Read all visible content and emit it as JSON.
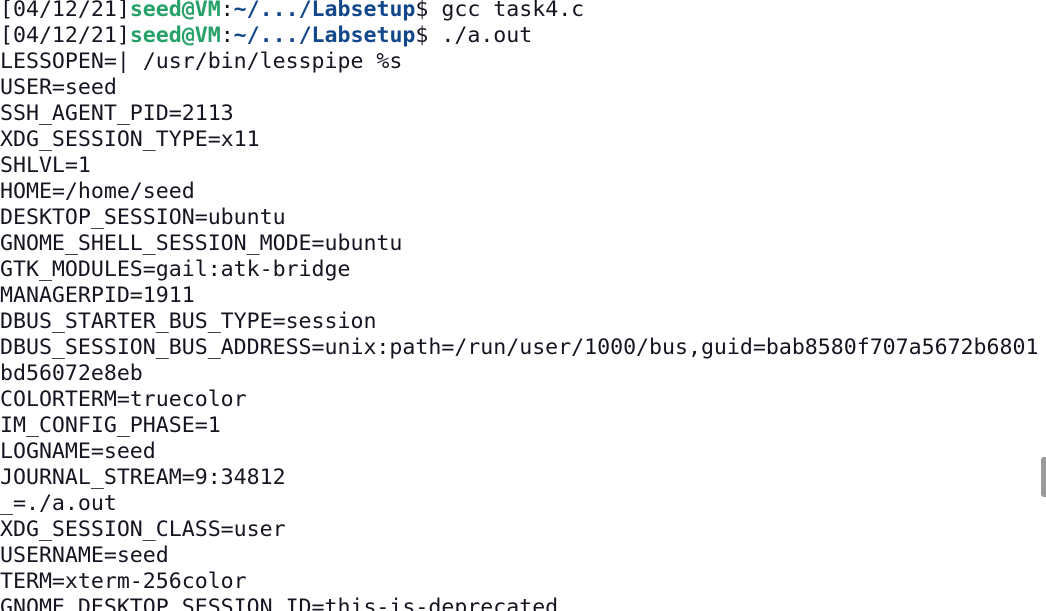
{
  "terminal": {
    "prompts": [
      {
        "time": "[04/12/21]",
        "user": "seed@VM",
        "sep": ":",
        "path": "~/.../Labsetup",
        "suffix": "$ ",
        "command": "gcc task4.c"
      },
      {
        "time": "[04/12/21]",
        "user": "seed@VM",
        "sep": ":",
        "path": "~/.../Labsetup",
        "suffix": "$ ",
        "command": "./a.out"
      }
    ],
    "output": [
      "LESSOPEN=| /usr/bin/lesspipe %s",
      "USER=seed",
      "SSH_AGENT_PID=2113",
      "XDG_SESSION_TYPE=x11",
      "SHLVL=1",
      "HOME=/home/seed",
      "DESKTOP_SESSION=ubuntu",
      "GNOME_SHELL_SESSION_MODE=ubuntu",
      "GTK_MODULES=gail:atk-bridge",
      "MANAGERPID=1911",
      "DBUS_STARTER_BUS_TYPE=session",
      "DBUS_SESSION_BUS_ADDRESS=unix:path=/run/user/1000/bus,guid=bab8580f707a5672b6801",
      "bd56072e8eb",
      "COLORTERM=truecolor",
      "IM_CONFIG_PHASE=1",
      "LOGNAME=seed",
      "JOURNAL_STREAM=9:34812",
      "_=./a.out",
      "XDG_SESSION_CLASS=user",
      "USERNAME=seed",
      "TERM=xterm-256color",
      "GNOME_DESKTOP_SESSION_ID=this-is-deprecated"
    ]
  },
  "colors": {
    "background": "#ffffff",
    "text": "#171421",
    "prompt_user": "#26a269",
    "prompt_path": "#12488b"
  }
}
